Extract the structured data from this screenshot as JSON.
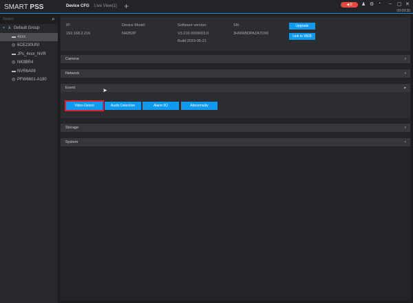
{
  "app": {
    "logo_light": "SMART ",
    "logo_bold": "PSS",
    "tabs": [
      {
        "label": "Device CFG"
      },
      {
        "label": "Live View(1)"
      }
    ],
    "add_tab": "+",
    "alarm_count": "0",
    "clock": "09:09:35"
  },
  "sidebar": {
    "search_placeholder": "Search",
    "group": "Default Group",
    "devices": [
      {
        "label": "4xxx",
        "icon": "nvr-icon"
      },
      {
        "label": "6CE230UNI",
        "icon": "camera-icon"
      },
      {
        "label": "JPs_4xxx_NVR",
        "icon": "nvr-icon"
      },
      {
        "label": "NK8BR4",
        "icon": "camera-icon"
      },
      {
        "label": "NVR6A08",
        "icon": "nvr-icon"
      },
      {
        "label": "PFW6601-A180",
        "icon": "camera-icon"
      }
    ]
  },
  "device": {
    "ip_label": "IP:",
    "ip": "192.168.2.216",
    "model_label": "Device Model:",
    "model": "N42B2P",
    "sw_label": "Software version:",
    "sw": "V3.216.0000003.0",
    "build": "Build:2019-05-21",
    "sn_label": "SN:",
    "sn": "3H066BDPAZA7D00",
    "upgrade": "Upgrade",
    "link_web": "Link to WEB"
  },
  "sections": {
    "camera": "Camera",
    "network": "Network",
    "event": "Event",
    "storage": "Storage",
    "system": "System"
  },
  "event_buttons": [
    "Video Detect",
    "Audio Detection",
    "Alarm I/O",
    "Abnormality"
  ],
  "colors": {
    "accent": "#0f9aef",
    "selected_outline": "#e0202a",
    "alarm": "#e5483f"
  }
}
